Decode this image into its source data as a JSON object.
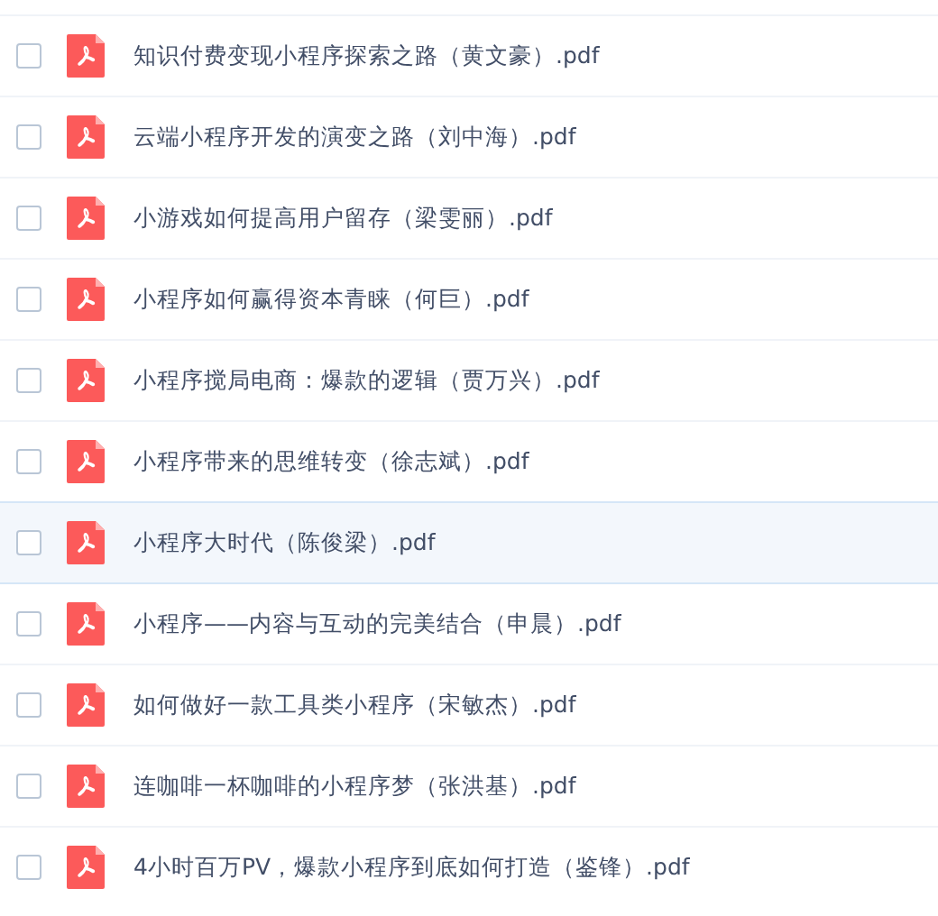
{
  "files": [
    {
      "name": "知识付费变现小程序探索之路（黄文豪）.pdf",
      "checked": false,
      "highlighted": false
    },
    {
      "name": "云端小程序开发的演变之路（刘中海）.pdf",
      "checked": false,
      "highlighted": false
    },
    {
      "name": "小游戏如何提高用户留存（梁雯丽）.pdf",
      "checked": false,
      "highlighted": false
    },
    {
      "name": "小程序如何赢得资本青睐（何巨）.pdf",
      "checked": false,
      "highlighted": false
    },
    {
      "name": "小程序搅局电商：爆款的逻辑（贾万兴）.pdf",
      "checked": false,
      "highlighted": false
    },
    {
      "name": "小程序带来的思维转变（徐志斌）.pdf",
      "checked": false,
      "highlighted": false
    },
    {
      "name": "小程序大时代（陈俊梁）.pdf",
      "checked": false,
      "highlighted": true
    },
    {
      "name": "小程序——内容与互动的完美结合（申晨）.pdf",
      "checked": false,
      "highlighted": false
    },
    {
      "name": "如何做好一款工具类小程序（宋敏杰）.pdf",
      "checked": false,
      "highlighted": false
    },
    {
      "name": "连咖啡一杯咖啡的小程序梦（张洪基）.pdf",
      "checked": false,
      "highlighted": false
    },
    {
      "name": "4小时百万PV，爆款小程序到底如何打造（鉴锋）.pdf",
      "checked": false,
      "highlighted": false
    }
  ]
}
